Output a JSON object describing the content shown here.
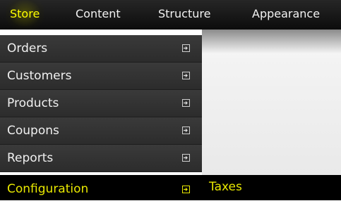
{
  "topnav": {
    "items": [
      {
        "label": "Store",
        "active": true
      },
      {
        "label": "Content",
        "active": false
      },
      {
        "label": "Structure",
        "active": false
      },
      {
        "label": "Appearance",
        "active": false
      }
    ]
  },
  "store_menu": {
    "items": [
      {
        "label": "Orders",
        "icon": "submenu-arrow-icon"
      },
      {
        "label": "Customers",
        "icon": "submenu-arrow-icon"
      },
      {
        "label": "Products",
        "icon": "submenu-arrow-icon"
      },
      {
        "label": "Coupons",
        "icon": "submenu-arrow-icon"
      },
      {
        "label": "Reports",
        "icon": "submenu-arrow-icon"
      }
    ],
    "active_item": {
      "label": "Configuration",
      "icon": "submenu-arrow-icon"
    },
    "submenu": {
      "label": "Taxes"
    }
  },
  "colors": {
    "active_text": "#e8e800",
    "menu_bg": "#333333",
    "bar_bg": "#000000"
  }
}
